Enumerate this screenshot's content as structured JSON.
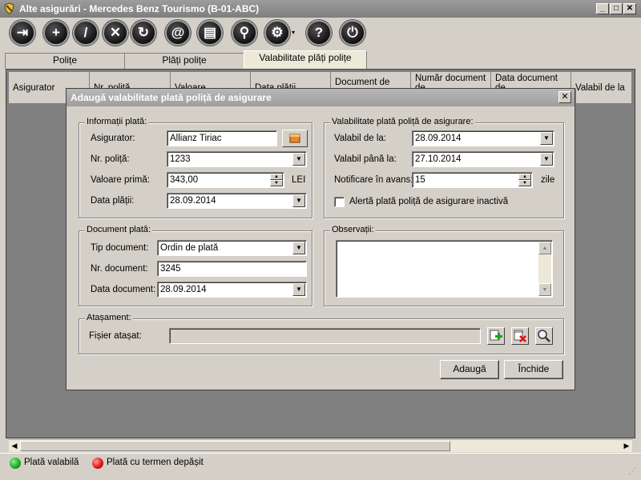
{
  "window": {
    "title": "Alte asigurări - Mercedes Benz Tourismo (B-01-ABC)",
    "minimize_glyph": "_",
    "maximize_glyph": "□",
    "close_glyph": "✕"
  },
  "toolbar": {
    "buttons": [
      {
        "name": "exit-icon",
        "glyph": "⇥"
      },
      {
        "name": "add-icon",
        "glyph": "+"
      },
      {
        "name": "edit-icon",
        "glyph": "/"
      },
      {
        "name": "delete-icon",
        "glyph": "✕"
      },
      {
        "name": "refresh-icon",
        "glyph": "↻"
      },
      {
        "name": "email-icon",
        "glyph": "@"
      },
      {
        "name": "print-icon",
        "glyph": "▤"
      },
      {
        "name": "search-icon",
        "glyph": "⚲"
      },
      {
        "name": "settings-icon",
        "glyph": "⚙"
      },
      {
        "name": "help-icon",
        "glyph": "?"
      },
      {
        "name": "power-icon",
        "glyph": "⏻"
      }
    ],
    "caret": "▾"
  },
  "tabs": [
    {
      "label": "Polițe",
      "active": false
    },
    {
      "label": "Plăți polițe",
      "active": false
    },
    {
      "label": "Valabilitate plăți polițe",
      "active": true
    }
  ],
  "grid": {
    "columns": [
      "Asigurator",
      "Nr. poliță",
      "Valoare",
      "Data plății",
      "Document de",
      "Număr document de",
      "Data document de",
      "Valabil de la"
    ]
  },
  "dialog": {
    "title": "Adaugă valabilitate plată poliță de asigurare",
    "close_glyph": "✕",
    "plata": {
      "legend": "Informații plată:",
      "asigurator_label": "Asigurator:",
      "asigurator_value": "Allianz Tiriac",
      "nr_polita_label": "Nr. poliță:",
      "nr_polita_value": "1233",
      "valoare_label": "Valoare primă:",
      "valoare_value": "343,00",
      "valoare_unit": "LEI",
      "data_platii_label": "Data plății:",
      "data_platii_value": "28.09.2014"
    },
    "valabilitate": {
      "legend": "Valabilitate plată poliță de asigurare:",
      "de_la_label": "Valabil de la:",
      "de_la_value": "28.09.2014",
      "pana_la_label": "Valabil până la:",
      "pana_la_value": "27.10.2014",
      "notificare_label": "Notificare în avans:",
      "notificare_value": "15",
      "notificare_unit": "zile",
      "alerta_label": "Alertă plată poliță de asigurare inactivă",
      "alerta_checked": false
    },
    "document": {
      "legend": "Document plată:",
      "tip_label": "Tip document:",
      "tip_value": "Ordin de plată",
      "nr_label": "Nr. document:",
      "nr_value": "3245",
      "data_label": "Data document:",
      "data_value": "28.09.2014"
    },
    "observatii": {
      "legend": "Observații:",
      "value": ""
    },
    "atasament": {
      "legend": "Atașament:",
      "fisier_label": "Fișier atașat:",
      "fisier_value": ""
    },
    "add_label": "Adaugă",
    "close_label": "Închide"
  },
  "status": {
    "valid_label": "Plată valabilă",
    "overdue_label": "Plată cu termen depășit",
    "valid_color": "#1aa51a",
    "overdue_color": "#e01010"
  }
}
